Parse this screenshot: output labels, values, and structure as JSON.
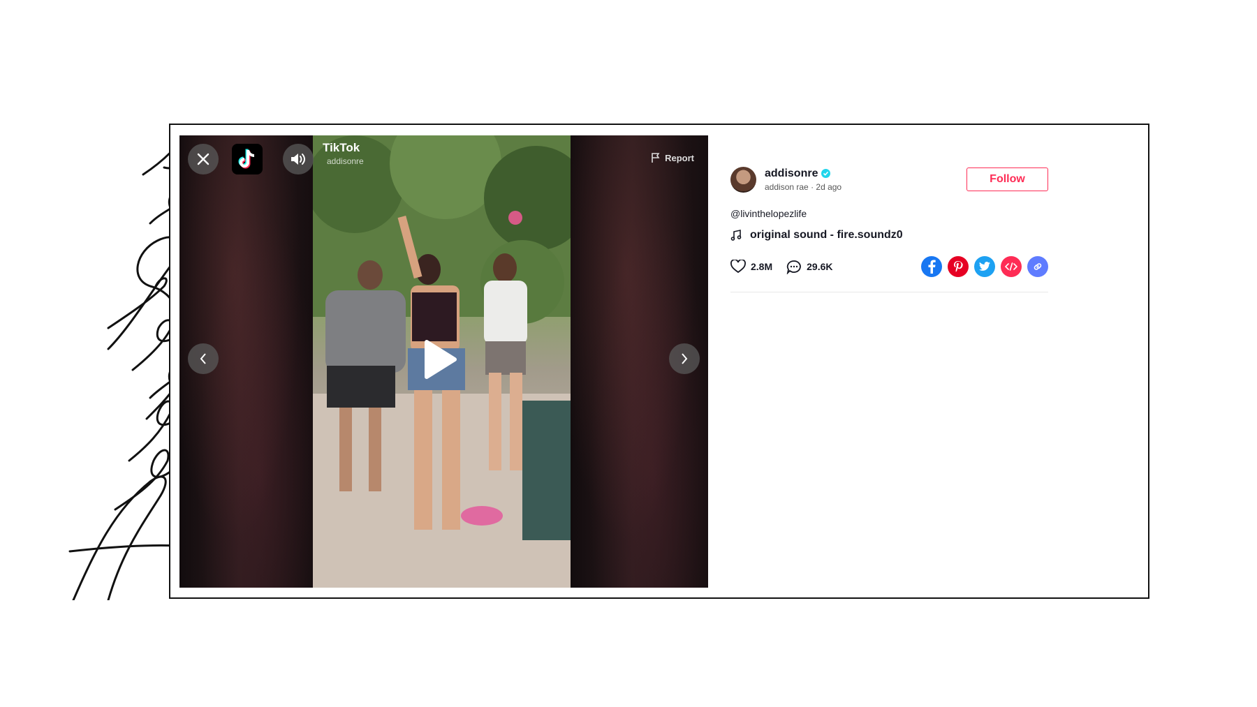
{
  "title_script": "Addison Rae",
  "player": {
    "watermark_brand": "TikTok",
    "watermark_handle": "addisonre",
    "report_label": "Report"
  },
  "post": {
    "username": "addisonre",
    "display_name": "addison rae",
    "time_ago": "2d ago",
    "follow_label": "Follow",
    "mention": "@livinthelopezlife",
    "sound": "original sound - fire.soundz0",
    "likes": "2.8M",
    "comments": "29.6K"
  },
  "colors": {
    "accent": "#fe2c55",
    "verified": "#20d5ec",
    "facebook": "#1877f2",
    "pinterest": "#e60023",
    "twitter": "#1da1f2",
    "embed": "#fe2c55",
    "link": "#5f7cff"
  },
  "icons": [
    "close-icon",
    "tiktok-logo",
    "volume-icon",
    "report-flag-icon",
    "play-icon",
    "chevron-left-icon",
    "chevron-right-icon",
    "verified-icon",
    "music-note-icon",
    "heart-icon",
    "comment-icon",
    "facebook-icon",
    "pinterest-icon",
    "twitter-icon",
    "embed-icon",
    "link-icon"
  ]
}
